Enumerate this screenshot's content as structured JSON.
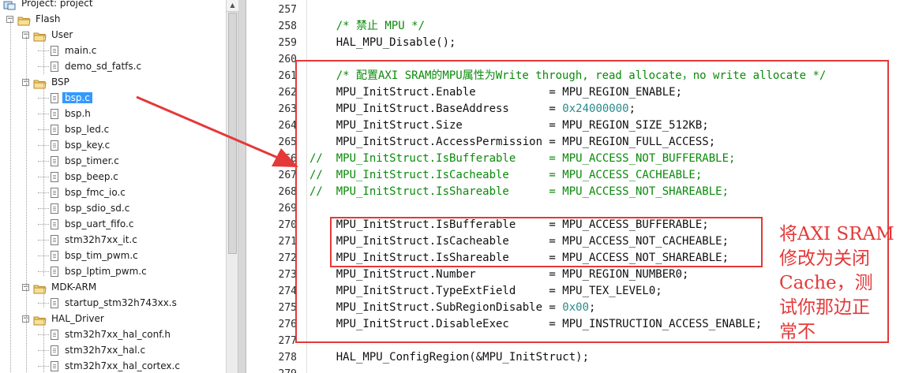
{
  "project_tree": {
    "items": [
      {
        "label": "Project: project",
        "kind": "project",
        "depth": 0
      },
      {
        "label": "Flash",
        "kind": "folder",
        "depth": 0
      },
      {
        "label": "User",
        "kind": "folder",
        "depth": 1
      },
      {
        "label": "main.c",
        "kind": "file",
        "depth": 2
      },
      {
        "label": "demo_sd_fatfs.c",
        "kind": "file",
        "depth": 2
      },
      {
        "label": "BSP",
        "kind": "folder",
        "depth": 1
      },
      {
        "label": "bsp.c",
        "kind": "file",
        "depth": 2,
        "selected": true
      },
      {
        "label": "bsp.h",
        "kind": "file",
        "depth": 2
      },
      {
        "label": "bsp_led.c",
        "kind": "file",
        "depth": 2
      },
      {
        "label": "bsp_key.c",
        "kind": "file",
        "depth": 2
      },
      {
        "label": "bsp_timer.c",
        "kind": "file",
        "depth": 2
      },
      {
        "label": "bsp_beep.c",
        "kind": "file",
        "depth": 2
      },
      {
        "label": "bsp_fmc_io.c",
        "kind": "file",
        "depth": 2
      },
      {
        "label": "bsp_sdio_sd.c",
        "kind": "file",
        "depth": 2
      },
      {
        "label": "bsp_uart_fifo.c",
        "kind": "file",
        "depth": 2
      },
      {
        "label": "stm32h7xx_it.c",
        "kind": "file",
        "depth": 2
      },
      {
        "label": "bsp_tim_pwm.c",
        "kind": "file",
        "depth": 2
      },
      {
        "label": "bsp_lptim_pwm.c",
        "kind": "file",
        "depth": 2
      },
      {
        "label": "MDK-ARM",
        "kind": "folder",
        "depth": 1
      },
      {
        "label": "startup_stm32h743xx.s",
        "kind": "file",
        "depth": 2
      },
      {
        "label": "HAL_Driver",
        "kind": "folder",
        "depth": 1
      },
      {
        "label": "stm32h7xx_hal_conf.h",
        "kind": "file",
        "depth": 2
      },
      {
        "label": "stm32h7xx_hal.c",
        "kind": "file",
        "depth": 2
      },
      {
        "label": "stm32h7xx_hal_cortex.c",
        "kind": "file",
        "depth": 2
      }
    ]
  },
  "editor": {
    "lines": [
      {
        "num": "257",
        "segments": []
      },
      {
        "num": "258",
        "segments": [
          {
            "t": "    ",
            "c": ""
          },
          {
            "t": "/* 禁止 MPU */",
            "c": "cm"
          }
        ]
      },
      {
        "num": "259",
        "segments": [
          {
            "t": "    HAL_MPU_Disable();",
            "c": ""
          }
        ]
      },
      {
        "num": "260",
        "segments": []
      },
      {
        "num": "261",
        "segments": [
          {
            "t": "    ",
            "c": ""
          },
          {
            "t": "/* 配置AXI SRAM的MPU属性为Write through, read allocate，no write allocate */",
            "c": "cm"
          }
        ]
      },
      {
        "num": "262",
        "segments": [
          {
            "t": "    MPU_InitStruct.Enable           = MPU_REGION_ENABLE;",
            "c": ""
          }
        ]
      },
      {
        "num": "263",
        "segments": [
          {
            "t": "    MPU_InitStruct.BaseAddress      = ",
            "c": ""
          },
          {
            "t": "0x24000000",
            "c": "hx"
          },
          {
            "t": ";",
            "c": ""
          }
        ]
      },
      {
        "num": "264",
        "segments": [
          {
            "t": "    MPU_InitStruct.Size             = MPU_REGION_SIZE_512KB;",
            "c": ""
          }
        ]
      },
      {
        "num": "265",
        "segments": [
          {
            "t": "    MPU_InitStruct.AccessPermission = MPU_REGION_FULL_ACCESS;",
            "c": ""
          }
        ]
      },
      {
        "num": "266",
        "segments": [
          {
            "t": "//  MPU_InitStruct.IsBufferable     = MPU_ACCESS_NOT_BUFFERABLE;",
            "c": "cm"
          }
        ]
      },
      {
        "num": "267",
        "segments": [
          {
            "t": "//  MPU_InitStruct.IsCacheable      = MPU_ACCESS_CACHEABLE;",
            "c": "cm"
          }
        ]
      },
      {
        "num": "268",
        "segments": [
          {
            "t": "//  MPU_InitStruct.IsShareable      = MPU_ACCESS_NOT_SHAREABLE;",
            "c": "cm"
          }
        ]
      },
      {
        "num": "269",
        "segments": []
      },
      {
        "num": "270",
        "segments": [
          {
            "t": "    MPU_InitStruct.IsBufferable     = MPU_ACCESS_BUFFERABLE;",
            "c": ""
          }
        ]
      },
      {
        "num": "271",
        "segments": [
          {
            "t": "    MPU_InitStruct.IsCacheable      = MPU_ACCESS_NOT_CACHEABLE;",
            "c": ""
          }
        ]
      },
      {
        "num": "272",
        "segments": [
          {
            "t": "    MPU_InitStruct.IsShareable      = MPU_ACCESS_NOT_SHAREABLE;",
            "c": ""
          }
        ]
      },
      {
        "num": "273",
        "segments": [
          {
            "t": "    MPU_InitStruct.Number           = MPU_REGION_NUMBER0;",
            "c": ""
          }
        ]
      },
      {
        "num": "274",
        "segments": [
          {
            "t": "    MPU_InitStruct.TypeExtField     = MPU_TEX_LEVEL0;",
            "c": ""
          }
        ]
      },
      {
        "num": "275",
        "segments": [
          {
            "t": "    MPU_InitStruct.SubRegionDisable = ",
            "c": ""
          },
          {
            "t": "0x00",
            "c": "hx"
          },
          {
            "t": ";",
            "c": ""
          }
        ]
      },
      {
        "num": "276",
        "segments": [
          {
            "t": "    MPU_InitStruct.DisableExec      = MPU_INSTRUCTION_ACCESS_ENABLE;",
            "c": ""
          }
        ]
      },
      {
        "num": "277",
        "segments": []
      },
      {
        "num": "278",
        "segments": [
          {
            "t": "    HAL_MPU_ConfigRegion(&MPU_InitStruct);",
            "c": ""
          }
        ]
      },
      {
        "num": "279",
        "segments": []
      }
    ]
  },
  "annotation": {
    "note_lines": [
      "将AXI SRAM",
      "修改为关闭",
      "Cache，测",
      "试你那边正",
      "常不"
    ]
  },
  "colors": {
    "annotation_red": "#e53838",
    "comment_green": "#0a8a0a",
    "hex_teal": "#2a8a8a",
    "selection_blue": "#3399ff"
  }
}
